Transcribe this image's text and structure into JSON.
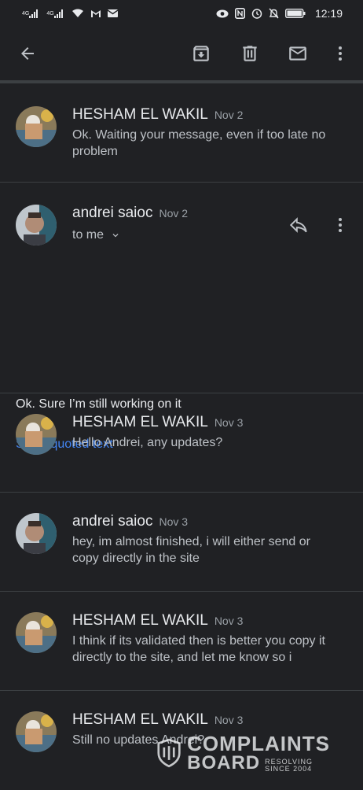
{
  "status_bar": {
    "network_1": "4G",
    "network_2": "4G",
    "time": "12:19"
  },
  "toolbar": {
    "icons": [
      "back-arrow-icon",
      "archive-icon",
      "delete-icon",
      "mark-unread-icon",
      "more-vert-icon"
    ]
  },
  "messages": [
    {
      "sender": "HESHAM EL WAKIL",
      "date": "Nov 2",
      "snippet": "Ok. Waiting your message, even if too late no problem"
    },
    {
      "sender": "andrei saioc",
      "date": "Nov 2",
      "recipients": "to me",
      "body": "Ok. Sure I’m still working on it",
      "quoted_link": "Show quoted text"
    },
    {
      "sender": "HESHAM EL WAKIL",
      "date": "Nov 3",
      "snippet": "Hello Andrei, any updates?"
    },
    {
      "sender": "andrei saioc",
      "date": "Nov 3",
      "snippet": "hey, im almost finished, i will either send or copy directly in the site"
    },
    {
      "sender": "HESHAM EL WAKIL",
      "date": "Nov 3",
      "snippet": "I think if its validated then is better you copy it directly to the site, and let me know so i"
    },
    {
      "sender": "HESHAM EL WAKIL",
      "date": "Nov 3",
      "snippet": "Still no updates Andrei?"
    }
  ],
  "watermark": {
    "line1": "COMPLAINTS",
    "line2": "BOARD",
    "tag1": "RESOLVING",
    "tag2": "SINCE 2004"
  },
  "colors": {
    "background": "#202124",
    "link": "#4285f4",
    "divider": "#3c4043"
  }
}
